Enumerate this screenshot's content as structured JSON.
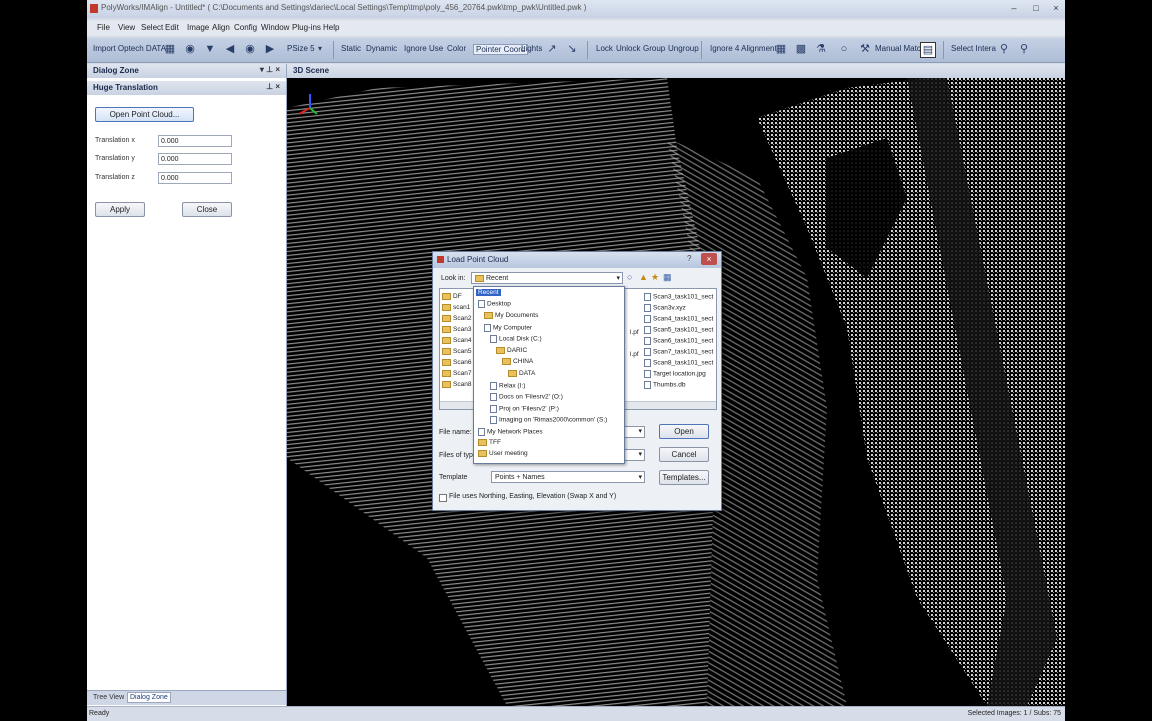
{
  "app": {
    "title": "PolyWorks/IMAlign - Untitled* ( C:\\Documents and Settings\\dariec\\Local Settings\\Temp\\tmp\\poly_456_20764.pwk\\tmp_pwk\\Untitled.pwk )"
  },
  "menu": [
    "File",
    "View",
    "Select",
    "Edit",
    "Image",
    "Align",
    "Config",
    "Window",
    "Plug-ins",
    "Help"
  ],
  "toolbar": {
    "import": "Import Optech DATA",
    "psize": "PSize 5",
    "static": "Static",
    "dynamic": "Dynamic",
    "ignore": "Ignore",
    "use": "Use",
    "color": "Color",
    "pointer_coord": "Pointer Coord",
    "lights": "Lights",
    "lock": "Lock",
    "unlock": "Unlock",
    "group": "Group",
    "ungroup": "Ungroup",
    "ignore4": "Ignore 4 Alignment",
    "manual_match": "Manual Match",
    "select_interactive": "Select Intera"
  },
  "dialog_zone": {
    "header": "Dialog Zone",
    "subheader": "Huge Translation",
    "open_button": "Open Point Cloud...",
    "fields": [
      {
        "label": "Translation x",
        "value": "0.000"
      },
      {
        "label": "Translation y",
        "value": "0.000"
      },
      {
        "label": "Translation z",
        "value": "0.000"
      }
    ],
    "apply": "Apply",
    "close": "Close"
  },
  "bottom_tabs": [
    "Tree View",
    "Dialog Zone"
  ],
  "status": {
    "left": "Ready",
    "right": "Selected Images: 1 / Subs: 75"
  },
  "scene": {
    "title": "3D Scene"
  },
  "load_dialog": {
    "title": "Load Point Cloud",
    "look_in_label": "Look in:",
    "look_in_value": "Recent",
    "left_list": [
      "DF",
      "scan1",
      "Scan2",
      "Scan3",
      "Scan4",
      "Scan5",
      "Scan6",
      "Scan7",
      "Scan8"
    ],
    "right_list": [
      "Scan3_task101_sect",
      "Scan3v.xyz",
      "Scan4_task101_sect",
      "Scan5_task101_sect",
      "Scan6_task101_sect",
      "Scan7_task101_sect",
      "Scan8_task101_sect",
      "Target location.jpg",
      "Thumbs.db"
    ],
    "mid_list": [
      "l.pf",
      "l.pf"
    ],
    "dropdown": [
      "Recent",
      "Desktop",
      "My Documents",
      "My Computer",
      "Local Disk (C:)",
      "DARIC",
      "CHINA",
      "DATA",
      "Relax (I:)",
      "Docs on 'Filesrv2' (O:)",
      "Proj on 'Filesrv2' (P:)",
      "Imaging on 'Rimas2000\\common' (S:)",
      "My Network Places",
      "TFF",
      "User meeting"
    ],
    "file_name_label": "File name:",
    "files_of_type_label": "Files of type:",
    "template_label": "Template",
    "template_value": "Points + Names",
    "open": "Open",
    "cancel": "Cancel",
    "templates": "Templates...",
    "checkbox_label": "File uses Northing, Easting, Elevation (Swap X and Y)"
  }
}
